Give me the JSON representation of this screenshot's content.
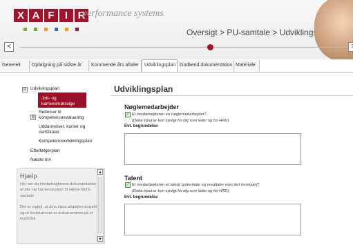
{
  "header": {
    "logo_letters": [
      "X",
      "A",
      "F",
      "I",
      "R"
    ],
    "tagline": "performance systems",
    "breadcrumb": "Oversigt > PU-samtale > Udviklingsplan",
    "dot_colors": [
      "#6cb33f",
      "#6cb33f",
      "#e3a21a",
      "#2f6fb5",
      "#e3a21a",
      "#a5112b"
    ],
    "nav_left_arrow": "<",
    "nav_right_arrow": ">"
  },
  "tabs": [
    {
      "label": "Generelt"
    },
    {
      "label": "Opfølgning på sidste år"
    },
    {
      "label": "Kommende års aftaler"
    },
    {
      "label": "Udviklingsplan",
      "active": true
    },
    {
      "label": "Godkend dokumentation"
    },
    {
      "label": "Materiale"
    }
  ],
  "sidebar": {
    "tree": {
      "expander": "⊟",
      "sub_expander": "⊞",
      "root": "Udviklingsplan",
      "selected": "Job- og karrieremæssige ønsker",
      "items": [
        "Rettelser til kompetenceevaluering",
        "Uddannelser, kurser og certifikater",
        "Kompetenceudviklingsplan"
      ],
      "after": [
        "Efterfølgerplan",
        "Næste trin"
      ]
    },
    "help": {
      "title": "Hjælp",
      "text1": "Her ser du medarbejderens dokumentation af job- og karriereønsker til næste MUS-samtale",
      "text2": "Det er vigtigt, at dine input afspejles korrekt, og at konklusioner er dokumenteret på et realistisk",
      "scroll_up": "▲",
      "scroll_down": "▼"
    }
  },
  "main": {
    "title": "Udviklingsplan",
    "sections": [
      {
        "title": "Nøglemedarbejder",
        "question": "Er medarbejderen en nøglemedarbejder?",
        "note": "(Dette input er kun synligt for dig som leder og for HRD)",
        "field_label": "Evt. begrundelse",
        "checked": true,
        "check_mark": "✓"
      },
      {
        "title": "Talent",
        "question": "Er medarbejderen et talent (potentiale og resultater over det normale)?",
        "note": "(Dette input er kun synligt for dig som leder og for HRD)",
        "field_label": "Evt. begrundelse",
        "checked": true,
        "check_mark": "✓"
      }
    ]
  }
}
